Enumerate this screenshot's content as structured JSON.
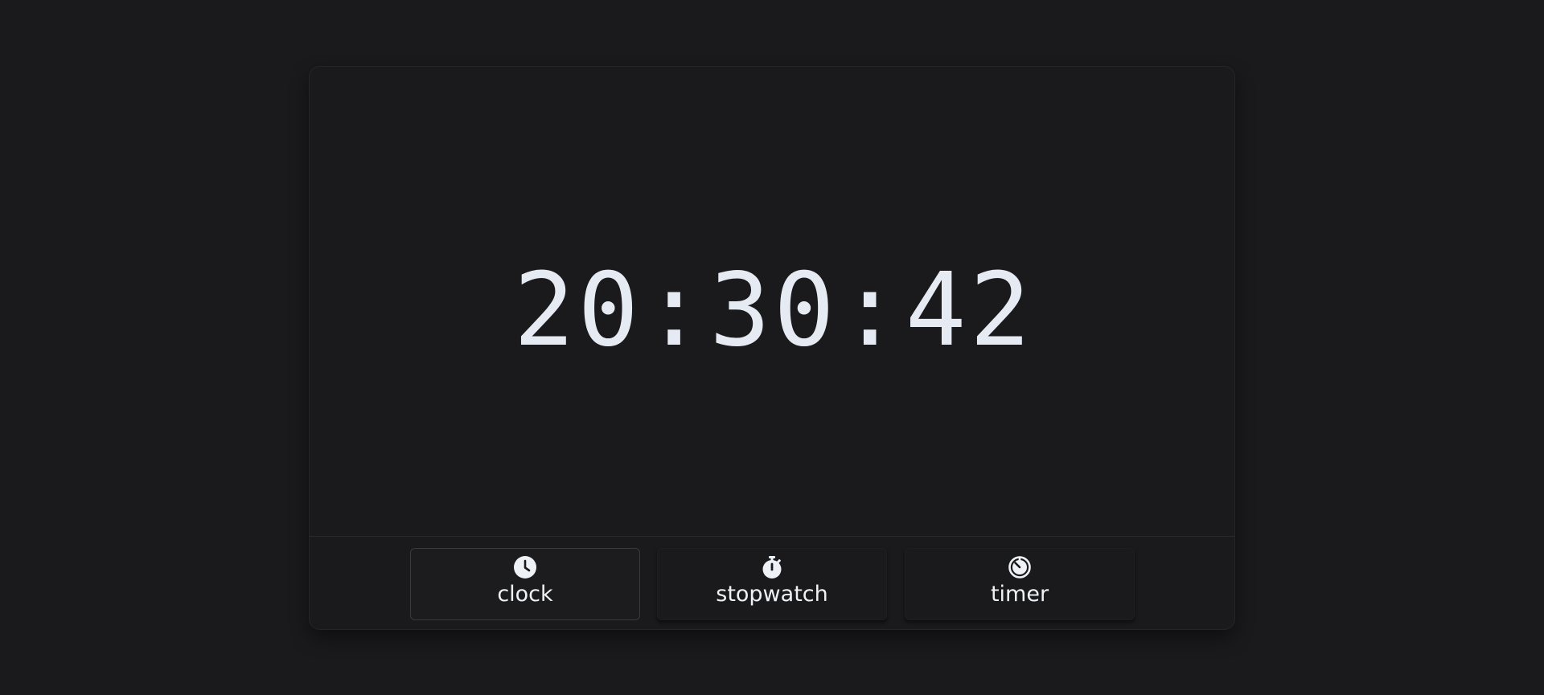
{
  "clock": {
    "hours": "20",
    "minutes": "30",
    "seconds": "42",
    "separator": ":"
  },
  "tabs": [
    {
      "label": "clock",
      "icon": "clock-icon",
      "active": true
    },
    {
      "label": "stopwatch",
      "icon": "stopwatch-icon",
      "active": false
    },
    {
      "label": "timer",
      "icon": "timer-icon",
      "active": false
    }
  ],
  "colors": {
    "background": "#1a1a1c",
    "text": "#e6ebf3",
    "border": "#2a2a2d"
  }
}
